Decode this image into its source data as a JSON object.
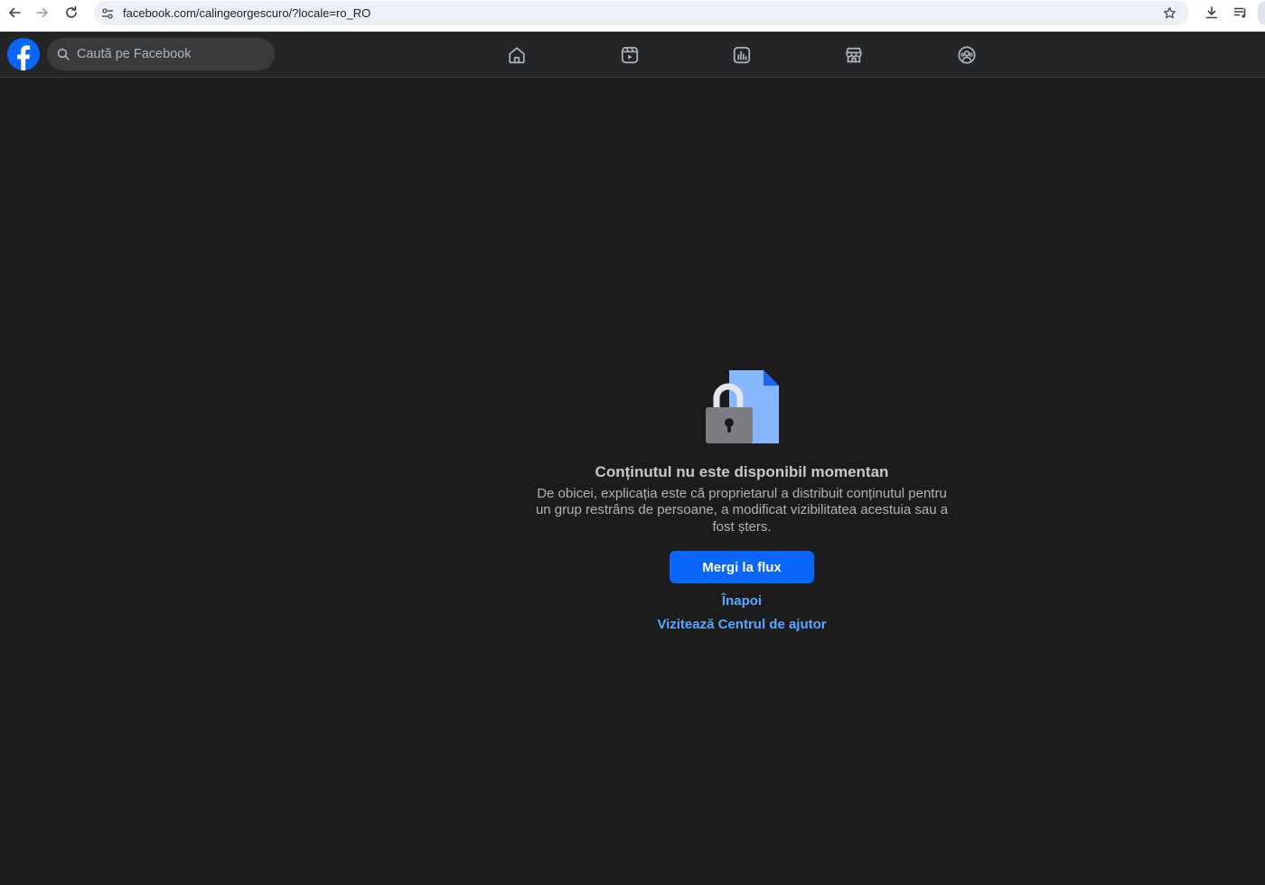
{
  "browser": {
    "url": "facebook.com/calingeorgescuro/?locale=ro_RO",
    "icons": {
      "back": "arrow-left-icon",
      "forward": "arrow-right-icon",
      "reload": "reload-icon",
      "site_info": "tune-icon",
      "bookmark": "star-icon",
      "downloads": "download-icon",
      "reading_list": "reading-list-icon"
    }
  },
  "fb": {
    "search_placeholder": "Caută pe Facebook",
    "nav": [
      "home-icon",
      "video-icon",
      "stats-icon",
      "marketplace-icon",
      "groups-icon"
    ],
    "colors": {
      "brand": "#0866ff",
      "link": "#5aa7ff",
      "background": "#1c1c1d",
      "topbar": "#242526"
    }
  },
  "error": {
    "illustration": "locked-document-icon",
    "title": "Conținutul nu este disponibil momentan",
    "description": "De obicei, explicația este că proprietarul a distribuit conținutul pentru un grup restrâns de persoane, a modificat vizibilitatea acestuia sau a fost șters.",
    "primary_button": "Mergi la flux",
    "back_link": "Înapoi",
    "help_link": "Vizitează Centrul de ajutor"
  }
}
